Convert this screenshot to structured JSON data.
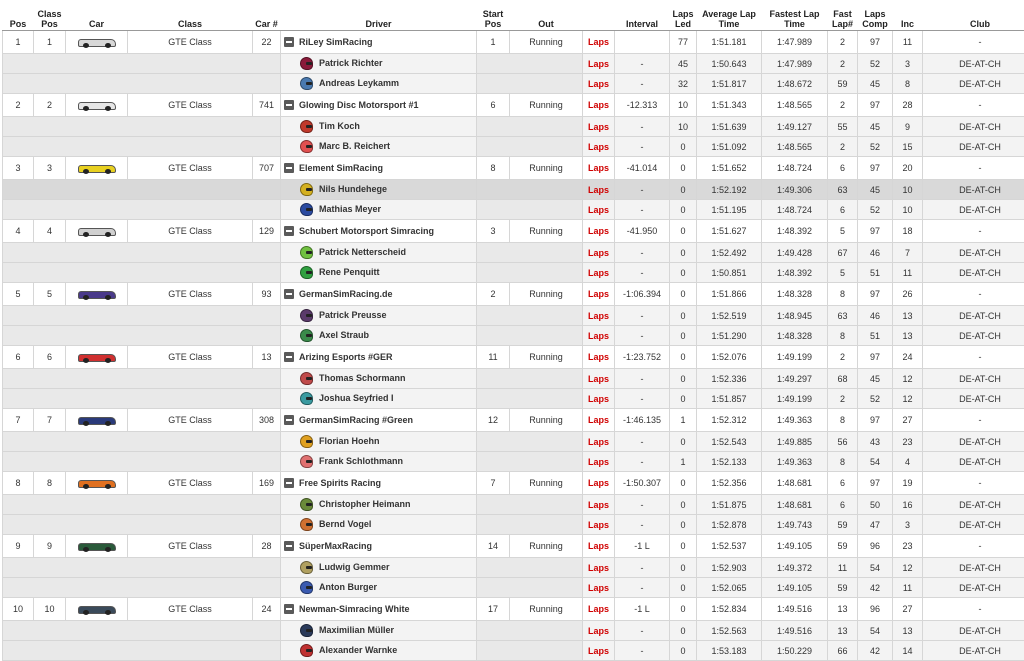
{
  "headers": {
    "pos": "Pos",
    "class_pos": "Class Pos",
    "car": "Car",
    "class": "Class",
    "car_num": "Car #",
    "driver": "Driver",
    "start_pos": "Start Pos",
    "out": "Out",
    "blank": "",
    "interval": "Interval",
    "laps_led": "Laps Led",
    "avg_lap": "Average Lap Time",
    "fastest_lap": "Fastest Lap Time",
    "fast_lap_num": "Fast Lap#",
    "laps_comp": "Laps Comp",
    "inc": "Inc",
    "club": "Club"
  },
  "rows": [
    {
      "type": "team",
      "pos": "1",
      "class_pos": "1",
      "car_color": "#d8d8d8",
      "class": "GTE Class",
      "car": "22",
      "name": "RiLey SimRacing",
      "start": "1",
      "out": "Running",
      "laps": "Laps",
      "interval": "",
      "led": "77",
      "avg": "1:51.181",
      "fast": "1:47.989",
      "fastlap": "2",
      "comp": "97",
      "inc": "11",
      "club": "-"
    },
    {
      "type": "driver",
      "helmet": "#8a1a3a",
      "name": "Patrick Richter",
      "laps": "Laps",
      "interval": "-",
      "led": "45",
      "avg": "1:50.643",
      "fast": "1:47.989",
      "fastlap": "2",
      "comp": "52",
      "inc": "3",
      "club": "DE-AT-CH"
    },
    {
      "type": "driver",
      "helmet": "#4a7ab0",
      "name": "Andreas Leykamm",
      "laps": "Laps",
      "interval": "-",
      "led": "32",
      "avg": "1:51.817",
      "fast": "1:48.672",
      "fastlap": "59",
      "comp": "45",
      "inc": "8",
      "club": "DE-AT-CH"
    },
    {
      "type": "team",
      "pos": "2",
      "class_pos": "2",
      "car_color": "#e6e6e6",
      "class": "GTE Class",
      "car": "741",
      "name": "Glowing Disc Motorsport #1",
      "start": "6",
      "out": "Running",
      "laps": "Laps",
      "interval": "-12.313",
      "led": "10",
      "avg": "1:51.343",
      "fast": "1:48.565",
      "fastlap": "2",
      "comp": "97",
      "inc": "28",
      "club": "-"
    },
    {
      "type": "driver",
      "helmet": "#c0392b",
      "name": "Tim Koch",
      "laps": "Laps",
      "interval": "-",
      "led": "10",
      "avg": "1:51.639",
      "fast": "1:49.127",
      "fastlap": "55",
      "comp": "45",
      "inc": "9",
      "club": "DE-AT-CH"
    },
    {
      "type": "driver",
      "helmet": "#e05050",
      "name": "Marc B. Reichert",
      "laps": "Laps",
      "interval": "-",
      "led": "0",
      "avg": "1:51.092",
      "fast": "1:48.565",
      "fastlap": "2",
      "comp": "52",
      "inc": "15",
      "club": "DE-AT-CH"
    },
    {
      "type": "team",
      "pos": "3",
      "class_pos": "3",
      "car_color": "#e8d020",
      "class": "GTE Class",
      "car": "707",
      "name": "Element SimRacing",
      "start": "8",
      "out": "Running",
      "laps": "Laps",
      "interval": "-41.014",
      "led": "0",
      "avg": "1:51.652",
      "fast": "1:48.724",
      "fastlap": "6",
      "comp": "97",
      "inc": "20",
      "club": "-"
    },
    {
      "type": "driver",
      "highlight": true,
      "helmet": "#d4b020",
      "name": "Nils Hundehege",
      "laps": "Laps",
      "interval": "-",
      "led": "0",
      "avg": "1:52.192",
      "fast": "1:49.306",
      "fastlap": "63",
      "comp": "45",
      "inc": "10",
      "club": "DE-AT-CH"
    },
    {
      "type": "driver",
      "helmet": "#2a4aa0",
      "name": "Mathias Meyer",
      "laps": "Laps",
      "interval": "-",
      "led": "0",
      "avg": "1:51.195",
      "fast": "1:48.724",
      "fastlap": "6",
      "comp": "52",
      "inc": "10",
      "club": "DE-AT-CH"
    },
    {
      "type": "team",
      "pos": "4",
      "class_pos": "4",
      "car_color": "#d0d0d0",
      "class": "GTE Class",
      "car": "129",
      "name": "Schubert Motorsport Simracing",
      "start": "3",
      "out": "Running",
      "laps": "Laps",
      "interval": "-41.950",
      "led": "0",
      "avg": "1:51.627",
      "fast": "1:48.392",
      "fastlap": "5",
      "comp": "97",
      "inc": "18",
      "club": "-"
    },
    {
      "type": "driver",
      "helmet": "#70c040",
      "name": "Patrick Netterscheid",
      "laps": "Laps",
      "interval": "-",
      "led": "0",
      "avg": "1:52.492",
      "fast": "1:49.428",
      "fastlap": "67",
      "comp": "46",
      "inc": "7",
      "club": "DE-AT-CH"
    },
    {
      "type": "driver",
      "helmet": "#30a040",
      "name": "Rene Penquitt",
      "laps": "Laps",
      "interval": "-",
      "led": "0",
      "avg": "1:50.851",
      "fast": "1:48.392",
      "fastlap": "5",
      "comp": "51",
      "inc": "11",
      "club": "DE-AT-CH"
    },
    {
      "type": "team",
      "pos": "5",
      "class_pos": "5",
      "car_color": "#4a3a8a",
      "class": "GTE Class",
      "car": "93",
      "name": "GermanSimRacing.de",
      "start": "2",
      "out": "Running",
      "laps": "Laps",
      "interval": "-1:06.394",
      "led": "0",
      "avg": "1:51.866",
      "fast": "1:48.328",
      "fastlap": "8",
      "comp": "97",
      "inc": "26",
      "club": "-"
    },
    {
      "type": "driver",
      "helmet": "#5a3a6a",
      "name": "Patrick Preusse",
      "laps": "Laps",
      "interval": "-",
      "led": "0",
      "avg": "1:52.519",
      "fast": "1:48.945",
      "fastlap": "63",
      "comp": "46",
      "inc": "13",
      "club": "DE-AT-CH"
    },
    {
      "type": "driver",
      "helmet": "#3a8a4a",
      "name": "Axel Straub",
      "laps": "Laps",
      "interval": "-",
      "led": "0",
      "avg": "1:51.290",
      "fast": "1:48.328",
      "fastlap": "8",
      "comp": "51",
      "inc": "13",
      "club": "DE-AT-CH"
    },
    {
      "type": "team",
      "pos": "6",
      "class_pos": "6",
      "car_color": "#d03030",
      "class": "GTE Class",
      "car": "13",
      "name": "Arizing Esports #GER",
      "start": "11",
      "out": "Running",
      "laps": "Laps",
      "interval": "-1:23.752",
      "led": "0",
      "avg": "1:52.076",
      "fast": "1:49.199",
      "fastlap": "2",
      "comp": "97",
      "inc": "24",
      "club": "-"
    },
    {
      "type": "driver",
      "helmet": "#c04a4a",
      "name": "Thomas Schormann",
      "laps": "Laps",
      "interval": "-",
      "led": "0",
      "avg": "1:52.336",
      "fast": "1:49.297",
      "fastlap": "68",
      "comp": "45",
      "inc": "12",
      "club": "DE-AT-CH"
    },
    {
      "type": "driver",
      "helmet": "#3a9aa0",
      "name": "Joshua Seyfried I",
      "laps": "Laps",
      "interval": "-",
      "led": "0",
      "avg": "1:51.857",
      "fast": "1:49.199",
      "fastlap": "2",
      "comp": "52",
      "inc": "12",
      "club": "DE-AT-CH"
    },
    {
      "type": "team",
      "pos": "7",
      "class_pos": "7",
      "car_color": "#2a3a7a",
      "class": "GTE Class",
      "car": "308",
      "name": "GermanSimRacing #Green",
      "start": "12",
      "out": "Running",
      "laps": "Laps",
      "interval": "-1:46.135",
      "led": "1",
      "avg": "1:52.312",
      "fast": "1:49.363",
      "fastlap": "8",
      "comp": "97",
      "inc": "27",
      "club": "-"
    },
    {
      "type": "driver",
      "helmet": "#e0a020",
      "name": "Florian Hoehn",
      "laps": "Laps",
      "interval": "-",
      "led": "0",
      "avg": "1:52.543",
      "fast": "1:49.885",
      "fastlap": "56",
      "comp": "43",
      "inc": "23",
      "club": "DE-AT-CH"
    },
    {
      "type": "driver",
      "helmet": "#e07070",
      "name": "Frank Schlothmann",
      "laps": "Laps",
      "interval": "-",
      "led": "1",
      "avg": "1:52.133",
      "fast": "1:49.363",
      "fastlap": "8",
      "comp": "54",
      "inc": "4",
      "club": "DE-AT-CH"
    },
    {
      "type": "team",
      "pos": "8",
      "class_pos": "8",
      "car_color": "#e07020",
      "class": "GTE Class",
      "car": "169",
      "name": "Free Spirits Racing",
      "start": "7",
      "out": "Running",
      "laps": "Laps",
      "interval": "-1:50.307",
      "led": "0",
      "avg": "1:52.356",
      "fast": "1:48.681",
      "fastlap": "6",
      "comp": "97",
      "inc": "19",
      "club": "-"
    },
    {
      "type": "driver",
      "helmet": "#6a8a3a",
      "name": "Christopher Heimann",
      "laps": "Laps",
      "interval": "-",
      "led": "0",
      "avg": "1:51.875",
      "fast": "1:48.681",
      "fastlap": "6",
      "comp": "50",
      "inc": "16",
      "club": "DE-AT-CH"
    },
    {
      "type": "driver",
      "helmet": "#d07030",
      "name": "Bernd Vogel",
      "laps": "Laps",
      "interval": "-",
      "led": "0",
      "avg": "1:52.878",
      "fast": "1:49.743",
      "fastlap": "59",
      "comp": "47",
      "inc": "3",
      "club": "DE-AT-CH"
    },
    {
      "type": "team",
      "pos": "9",
      "class_pos": "9",
      "car_color": "#2a5a3a",
      "class": "GTE Class",
      "car": "28",
      "name": "SüperMaxRacing",
      "start": "14",
      "out": "Running",
      "laps": "Laps",
      "interval": "-1 L",
      "led": "0",
      "avg": "1:52.537",
      "fast": "1:49.105",
      "fastlap": "59",
      "comp": "96",
      "inc": "23",
      "club": "-"
    },
    {
      "type": "driver",
      "helmet": "#b0a060",
      "name": "Ludwig Gemmer",
      "laps": "Laps",
      "interval": "-",
      "led": "0",
      "avg": "1:52.903",
      "fast": "1:49.372",
      "fastlap": "11",
      "comp": "54",
      "inc": "12",
      "club": "DE-AT-CH"
    },
    {
      "type": "driver",
      "helmet": "#3a5ab0",
      "name": "Anton Burger",
      "laps": "Laps",
      "interval": "-",
      "led": "0",
      "avg": "1:52.065",
      "fast": "1:49.105",
      "fastlap": "59",
      "comp": "42",
      "inc": "11",
      "club": "DE-AT-CH"
    },
    {
      "type": "team",
      "pos": "10",
      "class_pos": "10",
      "car_color": "#3a4a5a",
      "class": "GTE Class",
      "car": "24",
      "name": "Newman-Simracing White",
      "start": "17",
      "out": "Running",
      "laps": "Laps",
      "interval": "-1 L",
      "led": "0",
      "avg": "1:52.834",
      "fast": "1:49.516",
      "fastlap": "13",
      "comp": "96",
      "inc": "27",
      "club": "-"
    },
    {
      "type": "driver",
      "helmet": "#2a3a5a",
      "name": "Maximilian Müller",
      "laps": "Laps",
      "interval": "-",
      "led": "0",
      "avg": "1:52.563",
      "fast": "1:49.516",
      "fastlap": "13",
      "comp": "54",
      "inc": "13",
      "club": "DE-AT-CH"
    },
    {
      "type": "driver",
      "helmet": "#c03030",
      "name": "Alexander Warnke",
      "laps": "Laps",
      "interval": "-",
      "led": "0",
      "avg": "1:53.183",
      "fast": "1:50.229",
      "fastlap": "66",
      "comp": "42",
      "inc": "14",
      "club": "DE-AT-CH"
    }
  ]
}
